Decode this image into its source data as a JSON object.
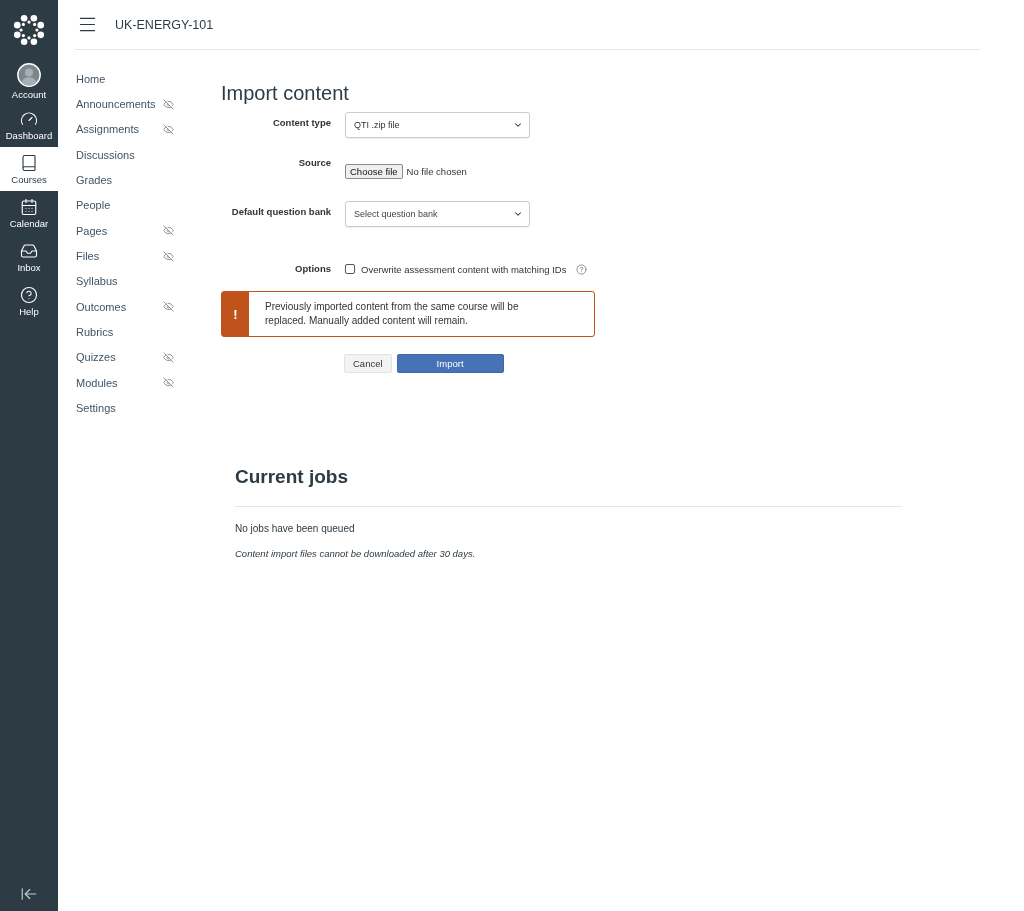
{
  "global_nav": {
    "items": [
      {
        "kind": "account",
        "label": "Account",
        "selected": false
      },
      {
        "kind": "dashboard",
        "label": "Dashboard",
        "selected": false
      },
      {
        "kind": "courses",
        "label": "Courses",
        "selected": true
      },
      {
        "kind": "calendar",
        "label": "Calendar",
        "selected": false
      },
      {
        "kind": "inbox",
        "label": "Inbox",
        "selected": false
      },
      {
        "kind": "help",
        "label": "Help",
        "selected": false
      }
    ]
  },
  "header": {
    "title": "UK-ENERGY-101"
  },
  "course_nav": {
    "items": [
      {
        "label": "Home",
        "hidden": false
      },
      {
        "label": "Announcements",
        "hidden": true
      },
      {
        "label": "Assignments",
        "hidden": true
      },
      {
        "label": "Discussions",
        "hidden": false
      },
      {
        "label": "Grades",
        "hidden": false
      },
      {
        "label": "People",
        "hidden": false
      },
      {
        "label": "Pages",
        "hidden": true
      },
      {
        "label": "Files",
        "hidden": true
      },
      {
        "label": "Syllabus",
        "hidden": false
      },
      {
        "label": "Outcomes",
        "hidden": true
      },
      {
        "label": "Rubrics",
        "hidden": false
      },
      {
        "label": "Quizzes",
        "hidden": true
      },
      {
        "label": "Modules",
        "hidden": true
      },
      {
        "label": "Settings",
        "hidden": false
      }
    ]
  },
  "import": {
    "title": "Import content",
    "fields": [
      {
        "kind": "select",
        "label": "Content type",
        "value": "QTI .zip file"
      },
      {
        "kind": "file",
        "label": "Source",
        "button": "Choose file",
        "status": "No file chosen"
      },
      {
        "kind": "select",
        "label": "Default question bank",
        "placeholder": "Select question bank"
      },
      {
        "kind": "checkbox",
        "label": "Options",
        "text": "Overwrite assessment content with matching IDs",
        "checked": false
      }
    ],
    "warning": {
      "icon": "!",
      "text": "Previously imported content from the same course will be replaced. Manually added content will remain."
    },
    "buttons": [
      {
        "kind": "secondary",
        "label": "Cancel"
      },
      {
        "kind": "primary",
        "label": "Import"
      }
    ]
  },
  "current_jobs": {
    "title": "Current jobs",
    "empty_text": "No jobs have been queued",
    "note": "Content import files cannot be downloaded after 30 days."
  }
}
